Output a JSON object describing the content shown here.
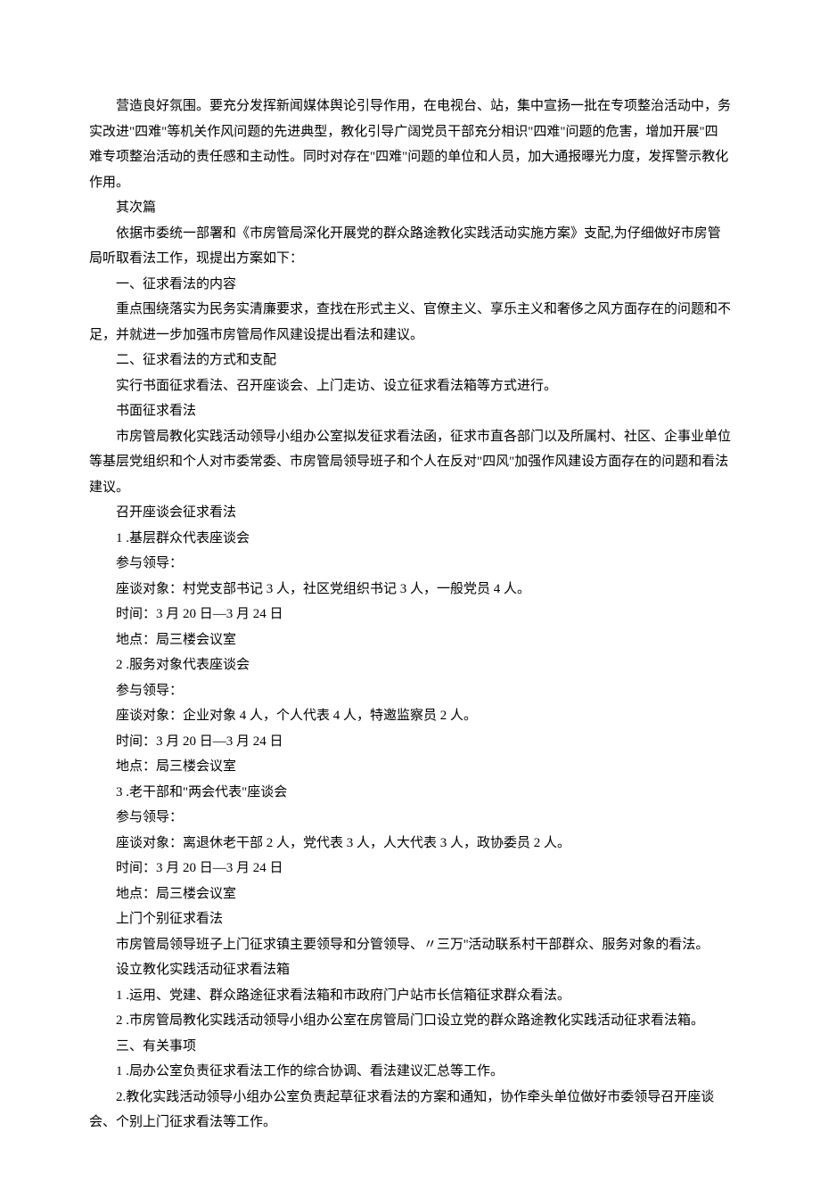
{
  "paragraphs": [
    "营造良好氛围。要充分发挥新闻媒体舆论引导作用，在电视台、站，集中宣扬一批在专项整治活动中，务实改进\"四难\"等机关作风问题的先进典型，教化引导广阔党员干部充分相识\"四难\"问题的危害，增加开展\"四难专项整治活动的责任感和主动性。同时对存在\"四难\"问题的单位和人员，加大通报曝光力度，发挥警示教化作用。",
    "其次篇",
    "依据市委统一部署和《市房管局深化开展党的群众路途教化实践活动实施方案》支配,为仔细做好市房管局听取看法工作，现提出方案如下：",
    "一、征求看法的内容",
    "重点围绕落实为民务实清廉要求，查找在形式主义、官僚主义、享乐主义和奢侈之风方面存在的问题和不足，并就进一步加强市房管局作风建设提出看法和建议。",
    "二、征求看法的方式和支配",
    "实行书面征求看法、召开座谈会、上门走访、设立征求看法箱等方式进行。",
    "书面征求看法",
    "市房管局教化实践活动领导小组办公室拟发征求看法函，征求市直各部门以及所属村、社区、企事业单位等基层党组织和个人对市委常委、市房管局领导班子和个人在反对\"四风\"加强作风建设方面存在的问题和看法建议。",
    "召开座谈会征求看法",
    "1 .基层群众代表座谈会",
    "参与领导：",
    "座谈对象：村党支部书记 3 人，社区党组织书记 3 人，一般党员 4 人。",
    "时间：3 月 20 日—3 月 24 日",
    "地点：局三楼会议室",
    "2  .服务对象代表座谈会",
    "参与领导：",
    "座谈对象：企业对象 4 人，个人代表 4 人，特邀监察员 2 人。",
    "时间：3 月 20 日—3 月 24 日",
    "地点：局三楼会议室",
    "3  .老干部和\"两会代表\"座谈会",
    "参与领导：",
    "座谈对象：离退休老干部 2 人，党代表 3 人，人大代表 3 人，政协委员 2 人。",
    "时间：3 月 20 日—3 月 24 日",
    "地点：局三楼会议室",
    "上门个别征求看法",
    "市房管局领导班子上门征求镇主要领导和分管领导、〃三万''活动联系村干部群众、服务对象的看法。",
    "设立教化实践活动征求看法箱",
    "1 .运用、党建、群众路途征求看法箱和市政府门户站市长信箱征求群众看法。",
    "2  .市房管局教化实践活动领导小组办公室在房管局门口设立党的群众路途教化实践活动征求看法箱。",
    "三、有关事项",
    "1 .局办公室负责征求看法工作的综合协调、看法建议汇总等工作。",
    "2.教化实践活动领导小组办公室负责起草征求看法的方案和通知，协作牵头单位做好市委领导召开座谈会、个别上门征求看法等工作。"
  ]
}
